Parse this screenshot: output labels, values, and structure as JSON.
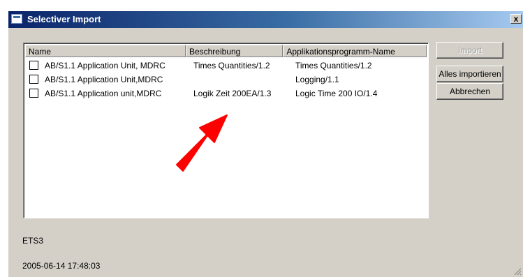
{
  "window": {
    "title": "Selectiver Import",
    "close_label": "x"
  },
  "list": {
    "columns": [
      "Name",
      "Beschreibung",
      "Applikationsprogramm-Name"
    ],
    "rows": [
      {
        "name": "AB/S1.1 Application Unit, MDRC",
        "description": "Times Quantities/1.2",
        "app_name": "Times Quantities/1.2",
        "checked": false
      },
      {
        "name": "AB/S1.1 Application Unit,MDRC",
        "description": "",
        "app_name": "Logging/1.1",
        "checked": false
      },
      {
        "name": "AB/S1.1 Application unit,MDRC",
        "description": "Logik Zeit 200EA/1.3",
        "app_name": "Logic Time 200 IO/1.4",
        "checked": false
      }
    ]
  },
  "buttons": {
    "import": "Import",
    "import_all": "Alles importieren",
    "cancel": "Abbrechen"
  },
  "status": {
    "line1": "ETS3",
    "line2": "2005-06-14 17:48:03"
  },
  "colors": {
    "annotation_arrow": "#ff0000",
    "titlebar_start": "#0a246a"
  }
}
